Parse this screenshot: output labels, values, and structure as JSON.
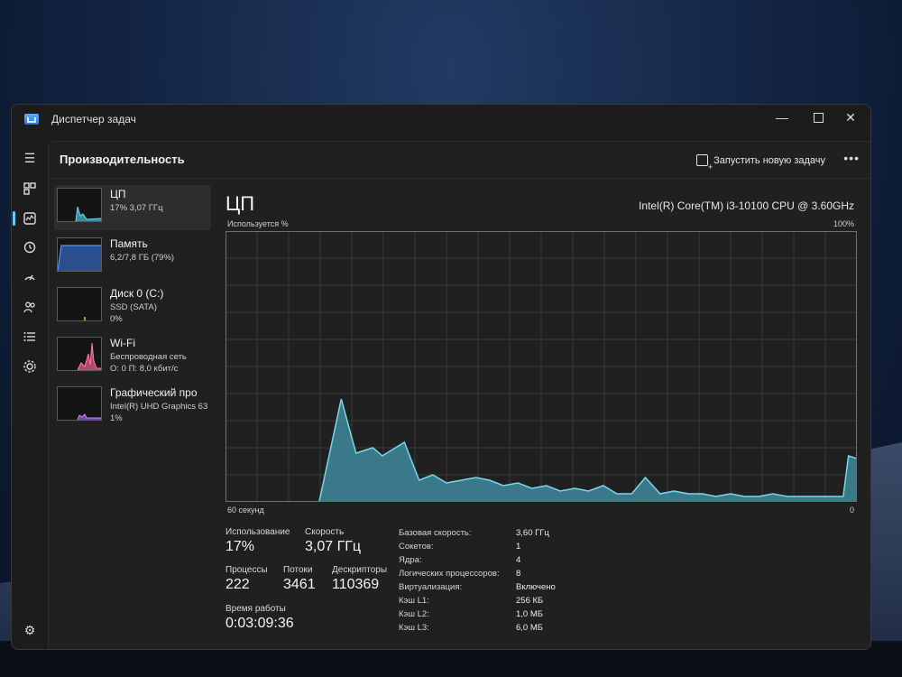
{
  "window": {
    "title": "Диспетчер задач"
  },
  "header": {
    "title": "Производительность",
    "run_task": "Запустить новую задачу",
    "more": "•••"
  },
  "devices": [
    {
      "name": "ЦП",
      "sub1": "17%  3,07 ГГц",
      "sub2": "",
      "sub3": ""
    },
    {
      "name": "Память",
      "sub1": "6,2/7,8 ГБ (79%)",
      "sub2": "",
      "sub3": ""
    },
    {
      "name": "Диск 0 (C:)",
      "sub1": "SSD (SATA)",
      "sub2": "0%",
      "sub3": ""
    },
    {
      "name": "Wi-Fi",
      "sub1": "Беспроводная сеть",
      "sub2": "О: 0  П: 8,0 кбит/с",
      "sub3": ""
    },
    {
      "name": "Графический про",
      "sub1": "Intel(R) UHD Graphics 63",
      "sub2": "1%",
      "sub3": ""
    }
  ],
  "cpu": {
    "title": "ЦП",
    "model": "Intel(R) Core(TM) i3-10100 CPU @ 3.60GHz",
    "util_label": "Используется %",
    "pct_max": "100%",
    "time_label": "60 секунд",
    "zero_label": "0"
  },
  "stats": {
    "usage_label": "Использование",
    "usage": "17%",
    "speed_label": "Скорость",
    "speed": "3,07 ГГц",
    "processes_label": "Процессы",
    "processes": "222",
    "threads_label": "Потоки",
    "threads": "3461",
    "handles_label": "Дескрипторы",
    "handles": "110369",
    "uptime_label": "Время работы",
    "uptime": "0:03:09:36"
  },
  "specs": [
    {
      "k": "Базовая скорость:",
      "v": "3,60 ГГц"
    },
    {
      "k": "Сокетов:",
      "v": "1"
    },
    {
      "k": "Ядра:",
      "v": "4"
    },
    {
      "k": "Логических процессоров:",
      "v": "8"
    },
    {
      "k": "Виртуализация:",
      "v": "Включено"
    },
    {
      "k": "Кэш L1:",
      "v": "256 КБ"
    },
    {
      "k": "Кэш L2:",
      "v": "1,0 МБ"
    },
    {
      "k": "Кэш L3:",
      "v": "6,0 МБ"
    }
  ],
  "chart_data": {
    "type": "area",
    "ylim": [
      0,
      100
    ],
    "xlim": [
      60,
      0
    ],
    "x": [
      60,
      51.1,
      49.0,
      47.6,
      46.0,
      45.1,
      43.0,
      41.6,
      40.3,
      39.0,
      37.6,
      36.2,
      34.9,
      33.6,
      32.2,
      30.9,
      29.5,
      28.2,
      26.8,
      25.5,
      24.1,
      22.8,
      21.4,
      20.1,
      18.7,
      17.4,
      16.0,
      14.7,
      13.4,
      12.0,
      10.7,
      9.3,
      8.0,
      6.6,
      5.3,
      3.9,
      2.6,
      1.3,
      0.8,
      0
    ],
    "values": [
      0,
      0,
      38,
      18,
      20,
      17,
      22,
      8,
      10,
      7,
      8,
      9,
      8,
      6,
      7,
      5,
      6,
      4,
      5,
      4,
      6,
      3,
      3,
      9,
      3,
      4,
      3,
      3,
      2,
      3,
      2,
      2,
      3,
      2,
      2,
      2,
      2,
      2,
      17,
      16
    ],
    "colors": {
      "line": "#7ad7e8",
      "fill": "#3e8a9e",
      "grid": "#3a3a3a",
      "border": "#6e6e6e"
    }
  }
}
